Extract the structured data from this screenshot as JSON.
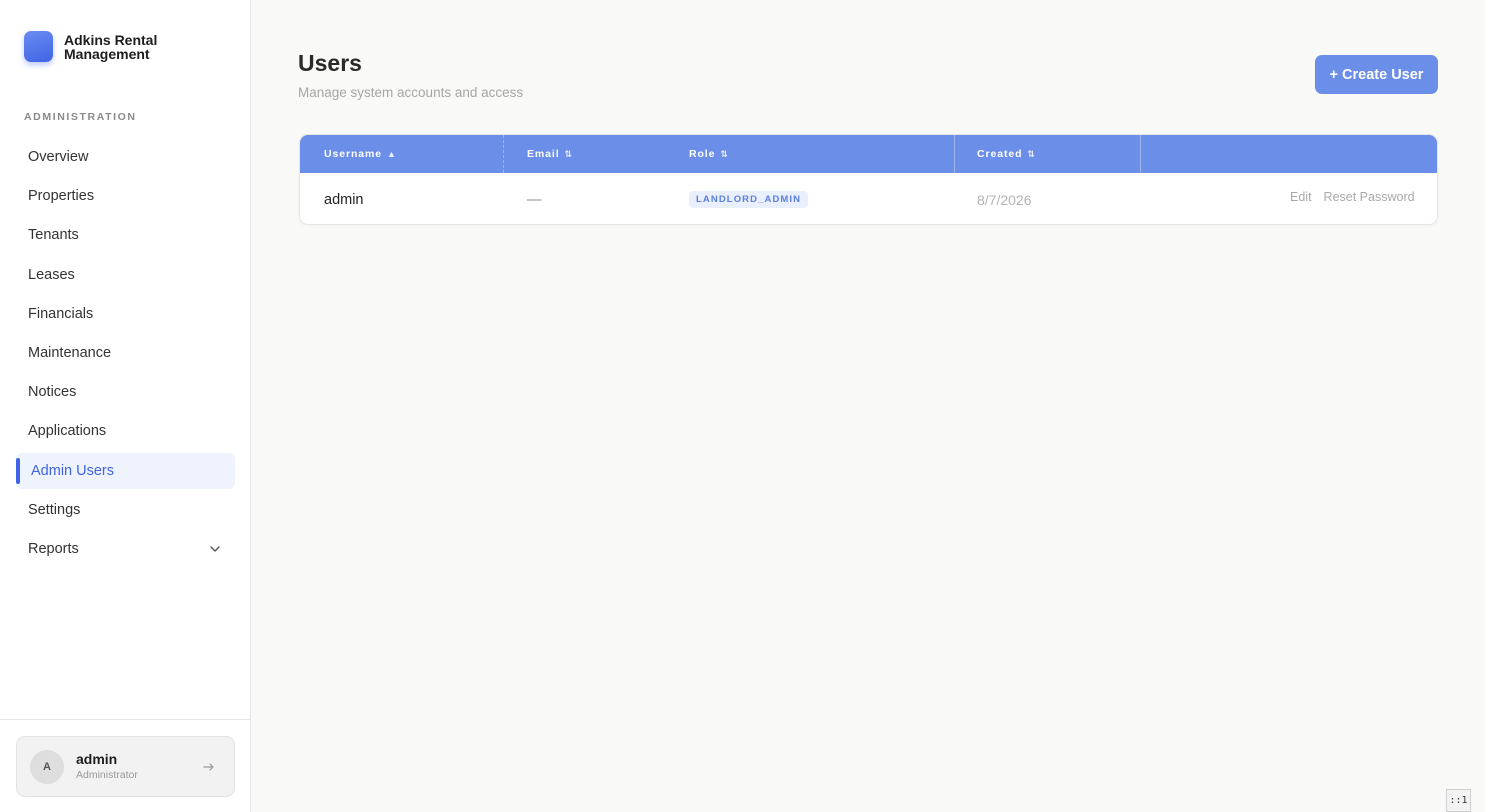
{
  "app": {
    "name": "Adkins Rental Management"
  },
  "sidebar": {
    "section_label": "ADMINISTRATION",
    "items": [
      {
        "label": "Overview"
      },
      {
        "label": "Properties"
      },
      {
        "label": "Tenants"
      },
      {
        "label": "Leases"
      },
      {
        "label": "Financials"
      },
      {
        "label": "Maintenance"
      },
      {
        "label": "Notices"
      },
      {
        "label": "Applications"
      },
      {
        "label": "Admin Users",
        "active": true
      },
      {
        "label": "Settings"
      },
      {
        "label": "Reports",
        "icon": "chevron-down-icon"
      }
    ],
    "user": {
      "initial": "A",
      "name": "admin",
      "role": "Administrator",
      "logout_icon": "arrow-right-icon"
    }
  },
  "page": {
    "title": "Users",
    "subtitle": "Manage system accounts and access",
    "create_button": "+ Create User"
  },
  "table": {
    "columns": [
      {
        "label": "Username",
        "sort": "▲"
      },
      {
        "label": "Email",
        "sort": "⇅"
      },
      {
        "label": "Role",
        "sort": "⇅"
      },
      {
        "label": "Created",
        "sort": "⇅"
      }
    ],
    "rows": [
      {
        "username": "admin",
        "email": "—",
        "role": "LANDLORD_ADMIN",
        "created": "8/7/2026",
        "actions": [
          "Edit",
          "Reset Password"
        ]
      }
    ]
  },
  "corner_badge": "::1",
  "colors": {
    "accent": "#3f64e4",
    "header": "#6b8ee9",
    "active_bg": "#eef3fe"
  }
}
